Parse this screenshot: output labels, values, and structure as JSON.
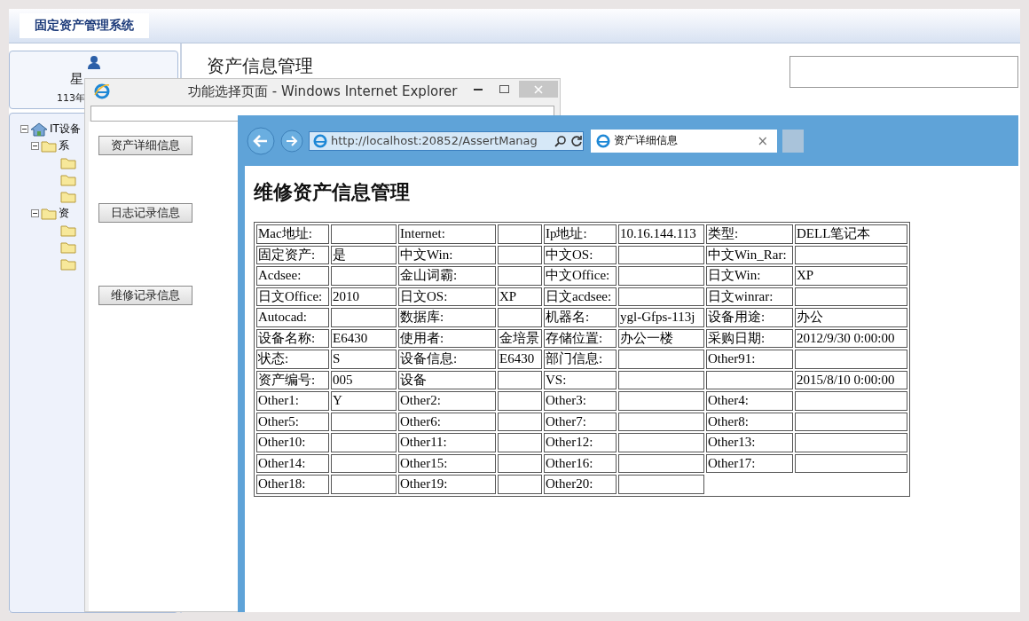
{
  "app": {
    "title": "固定资产管理系统",
    "user_name": "星",
    "user_info": "113年",
    "page_title": "资产信息管理",
    "tree": [
      {
        "kind": "home",
        "label": "IT设备",
        "expanded": true,
        "children": [
          {
            "kind": "folder",
            "label": "系",
            "expanded": true,
            "children": [
              {
                "kind": "folder"
              },
              {
                "kind": "folder"
              },
              {
                "kind": "folder"
              }
            ]
          },
          {
            "kind": "folder",
            "label": "资",
            "expanded": true,
            "children": [
              {
                "kind": "folder"
              },
              {
                "kind": "folder"
              },
              {
                "kind": "folder"
              }
            ]
          }
        ]
      }
    ]
  },
  "popup": {
    "title": "功能选择页面 - Windows Internet Explorer",
    "buttons": [
      "资产详细信息",
      "日志记录信息",
      "维修记录信息"
    ]
  },
  "browser": {
    "address": "http://localhost:20852/AssertManag",
    "tab": "资产详细信息",
    "tab_close": "×",
    "heading": "维修资产信息管理",
    "table": {
      "rows": [
        [
          "Mac地址:",
          null,
          "Internet:",
          null,
          "Ip地址:",
          "10.16.144.113",
          "类型:",
          "DELL笔记本"
        ],
        [
          "固定资产:",
          "是",
          "中文Win:",
          null,
          "中文OS:",
          null,
          "中文Win_Rar:",
          null
        ],
        [
          "Acdsee:",
          null,
          "金山词霸:",
          null,
          "中文Office:",
          null,
          "日文Win:",
          "XP"
        ],
        [
          "日文Office:",
          "2010",
          "日文OS:",
          "XP",
          "日文acdsee:",
          null,
          "日文winrar:",
          null
        ],
        [
          "Autocad:",
          null,
          "数据库:",
          null,
          "机器名:",
          "ygl-Gfps-113j",
          "设备用途:",
          "办公"
        ],
        [
          "设备名称:",
          "E6430",
          "使用者:",
          "金培景",
          "存储位置:",
          "办公一楼",
          "采购日期:",
          "2012/9/30 0:00:00"
        ],
        [
          "状态:",
          "S",
          "设备信息:",
          "E6430",
          "部门信息:",
          null,
          "Other91:",
          null
        ],
        [
          "资产编号:",
          "005",
          "设备",
          null,
          "VS:",
          null,
          null,
          "2015/8/10 0:00:00"
        ],
        [
          "Other1:",
          "Y",
          "Other2:",
          null,
          "Other3:",
          null,
          "Other4:",
          null
        ],
        [
          "Other5:",
          null,
          "Other6:",
          null,
          "Other7:",
          null,
          "Other8:",
          null
        ],
        [
          "Other10:",
          null,
          "Other11:",
          null,
          "Other12:",
          null,
          "Other13:",
          null
        ],
        [
          "Other14:",
          null,
          "Other15:",
          null,
          "Other16:",
          null,
          "Other17:",
          null
        ],
        [
          "Other18:",
          null,
          "Other19:",
          null,
          "Other20:",
          null
        ]
      ]
    }
  }
}
